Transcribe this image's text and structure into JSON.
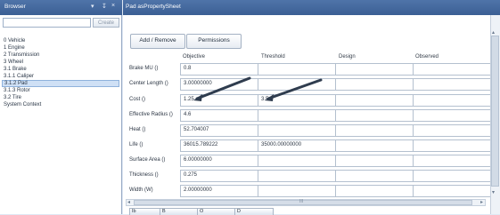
{
  "browser": {
    "title": "Browser",
    "controls": [
      "▾",
      "↧",
      "×"
    ],
    "search_value": "",
    "create_label": "Create",
    "items": [
      {
        "label": "0 Vehicle",
        "selected": false
      },
      {
        "label": "1 Engine",
        "selected": false
      },
      {
        "label": "2 Transmission",
        "selected": false
      },
      {
        "label": "3 Wheel",
        "selected": false
      },
      {
        "label": "3.1 Brake",
        "selected": false
      },
      {
        "label": "3.1.1 Caliper",
        "selected": false
      },
      {
        "label": "3.1.2 Pad",
        "selected": true
      },
      {
        "label": "3.1.3 Rotor",
        "selected": false
      },
      {
        "label": "3.2 Tire",
        "selected": false
      },
      {
        "label": "System Context",
        "selected": false
      }
    ]
  },
  "sheet": {
    "title": "Pad asPropertySheet",
    "toolbar": {
      "add_remove_label": "Add / Remove",
      "permissions_label": "Permissions"
    },
    "columns": [
      "Objective",
      "Threshold",
      "Design",
      "Observed"
    ],
    "rows": [
      {
        "label": "Brake MU ()",
        "values": [
          "0.8",
          "",
          "",
          ""
        ]
      },
      {
        "label": "Center Length ()",
        "values": [
          "3.00000000",
          "",
          "",
          ""
        ]
      },
      {
        "label": "Cost ()",
        "values": [
          "1.25",
          "3.5",
          "",
          ""
        ]
      },
      {
        "label": "Effective Radius ()",
        "values": [
          "4.6",
          "",
          "",
          ""
        ]
      },
      {
        "label": "Heat ()",
        "values": [
          "52.704007",
          "",
          "",
          ""
        ]
      },
      {
        "label": "Life ()",
        "values": [
          "36015.789222",
          "35000.00000000",
          "",
          ""
        ]
      },
      {
        "label": "Surface Area ()",
        "values": [
          "6.00000000",
          "",
          "",
          ""
        ]
      },
      {
        "label": "Thickness ()",
        "values": [
          "0.275",
          "",
          "",
          ""
        ]
      },
      {
        "label": "Width (W)",
        "values": [
          "2.00000000",
          "",
          "",
          ""
        ]
      }
    ],
    "scroll_grip": "III",
    "bottom_tabs": [
      "Ib",
      "B",
      "O",
      "D"
    ],
    "annotation_color": "#2f3c4e"
  },
  "icons": {
    "hscroll_left": "scroll-left-arrow-icon",
    "hscroll_right": "scroll-right-arrow-icon",
    "vscroll_up": "scroll-up-arrow-icon",
    "vscroll_down": "scroll-down-arrow-icon"
  }
}
